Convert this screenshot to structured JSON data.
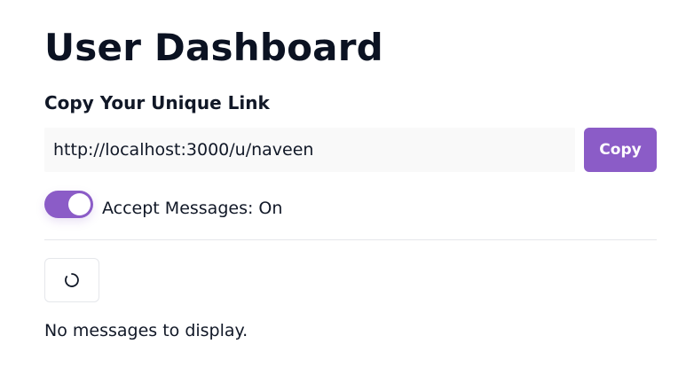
{
  "header": {
    "title": "User Dashboard"
  },
  "link_section": {
    "heading": "Copy Your Unique Link",
    "url_value": "http://localhost:3000/u/naveen",
    "copy_label": "Copy"
  },
  "accept_messages": {
    "label": "Accept Messages: On",
    "enabled": true
  },
  "refresh": {
    "icon": "loader-icon"
  },
  "messages": {
    "empty_text": "No messages to display."
  },
  "colors": {
    "accent": "#8b5cc7",
    "input_bg": "#f9f9f9",
    "divider": "#e5e7eb",
    "text": "#111827"
  }
}
